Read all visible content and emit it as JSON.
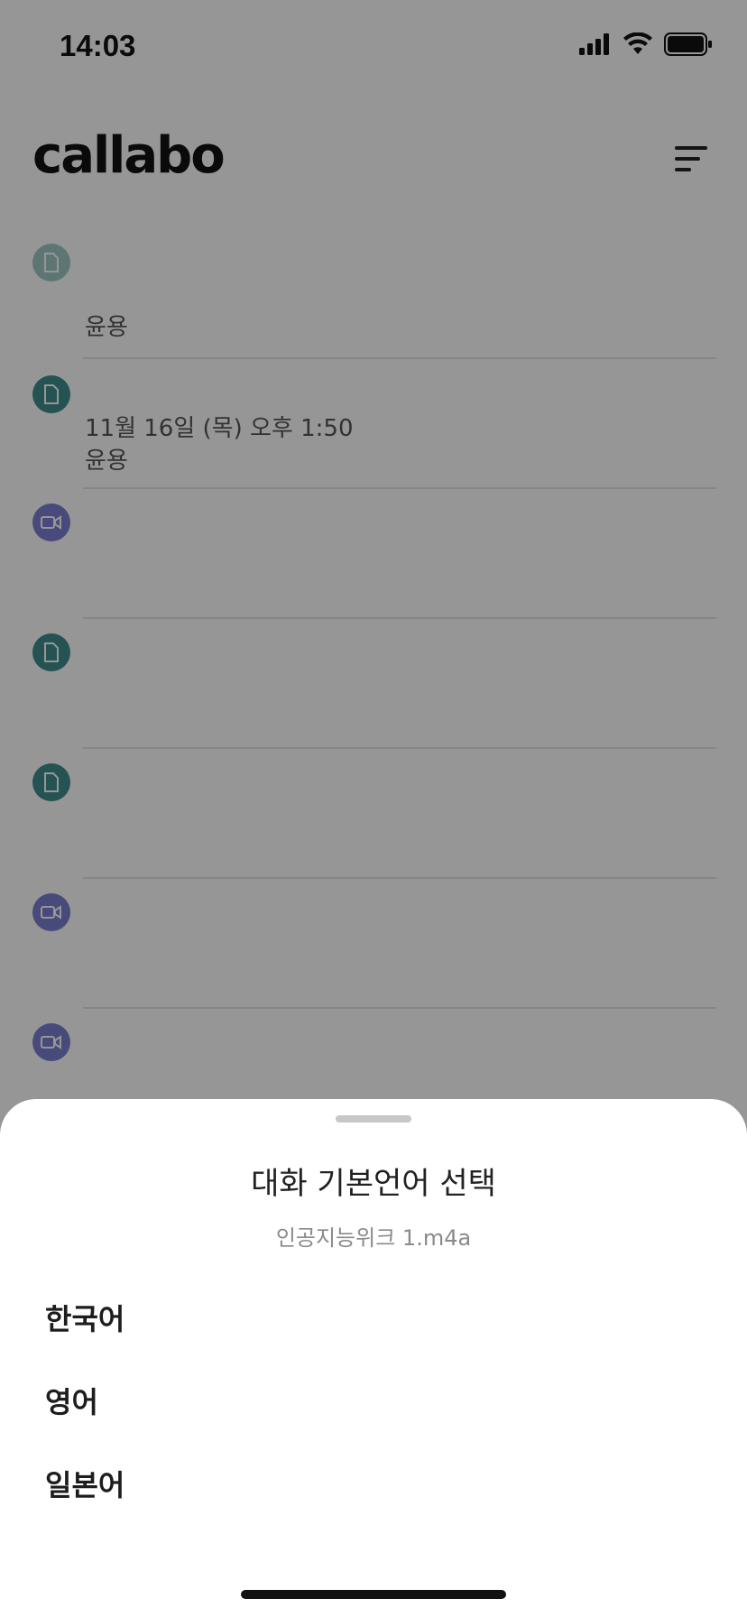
{
  "status_bar": {
    "time": "14:03",
    "icons": [
      "signal-icon",
      "wifi-icon",
      "battery-icon"
    ]
  },
  "header": {
    "logo": "callabo",
    "menu_icon": "sort-lines-icon"
  },
  "list": {
    "items": [
      {
        "icon": "document-icon",
        "meta_lines": [
          "윤용"
        ]
      },
      {
        "icon": "document-icon",
        "meta_lines": [
          "11월 16일 (목) 오후 1:50",
          "윤용"
        ]
      },
      {
        "icon": "video-icon",
        "meta_lines": []
      },
      {
        "icon": "document-icon",
        "meta_lines": []
      },
      {
        "icon": "document-icon",
        "meta_lines": []
      },
      {
        "icon": "video-icon",
        "meta_lines": []
      },
      {
        "icon": "video-icon",
        "meta_lines": []
      }
    ]
  },
  "sheet": {
    "title": "대화 기본언어 선택",
    "subtitle": "인공지능위크 1.m4a",
    "options": [
      "한국어",
      "영어",
      "일본어"
    ]
  },
  "colors": {
    "doc_icon": "#3f8c8c",
    "video_icon": "#7b7fd1",
    "overlay": "rgba(0,0,0,0.41)"
  }
}
